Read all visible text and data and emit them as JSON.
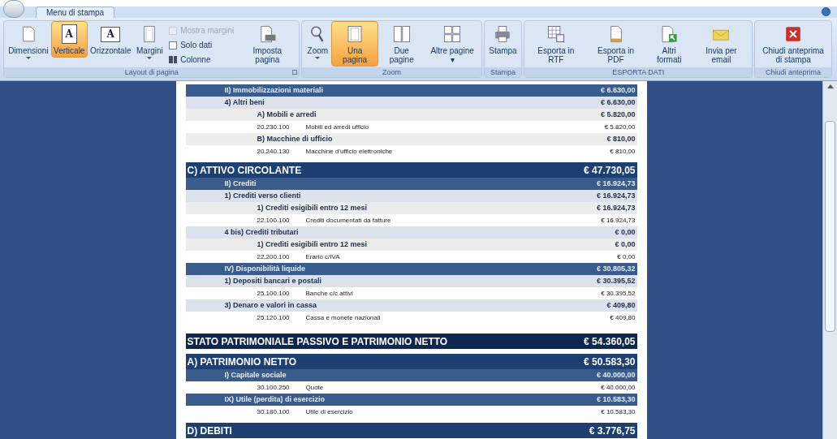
{
  "tabs": [
    {
      "label": "Menu di stampa",
      "selected": true
    }
  ],
  "ribbon": {
    "groups": [
      {
        "label": "Layout di pagina",
        "items": [
          {
            "kind": "button",
            "label": "Dimensioni",
            "dropdown": true,
            "selected": false
          },
          {
            "kind": "button",
            "glyph": "A",
            "label": "Verticale",
            "dropdown": false,
            "selected": true
          },
          {
            "kind": "button",
            "glyph": "A",
            "label": "Orizzontale",
            "dropdown": false,
            "selected": false
          },
          {
            "kind": "button",
            "label": "Margini",
            "dropdown": true,
            "selected": false
          },
          {
            "kind": "options",
            "options": [
              {
                "label": "Mostra margini",
                "kind": "checkbox",
                "checked": false,
                "disabled": true
              },
              {
                "label": "Solo dati",
                "kind": "checkbox",
                "checked": false,
                "disabled": false
              },
              {
                "label": "Colonne",
                "kind": "command"
              }
            ]
          },
          {
            "kind": "button",
            "label": "Imposta pagina",
            "dropdown": false,
            "selected": false
          }
        ]
      },
      {
        "label": "Zoom",
        "items": [
          {
            "kind": "button",
            "label": "Zoom",
            "dropdown": true,
            "selected": false
          },
          {
            "kind": "button",
            "label": "Una pagina",
            "dropdown": false,
            "selected": true
          },
          {
            "kind": "button",
            "label": "Due pagine",
            "dropdown": false,
            "selected": false
          },
          {
            "kind": "button",
            "label": "Altre pagine ▾",
            "dropdown": false,
            "selected": false
          }
        ]
      },
      {
        "label": "Stampa",
        "items": [
          {
            "kind": "button",
            "label": "Stampa",
            "dropdown": false,
            "selected": false
          }
        ]
      },
      {
        "label": "ESPORTA DATI",
        "items": [
          {
            "kind": "button",
            "label": "Esporta in RTF",
            "dropdown": false,
            "selected": false
          },
          {
            "kind": "button",
            "label": "Esporta in PDF",
            "dropdown": false,
            "selected": false
          },
          {
            "kind": "button",
            "label": "Altri formati",
            "dropdown": false,
            "selected": false
          },
          {
            "kind": "button",
            "label": "Invia per email",
            "dropdown": false,
            "selected": false
          }
        ]
      },
      {
        "label": "Chiudi anteprima",
        "items": [
          {
            "kind": "button",
            "label": "Chiudi anteprima di stampa",
            "dropdown": false,
            "selected": false
          }
        ]
      }
    ]
  },
  "report": {
    "rows": [
      {
        "kind": "category",
        "label": "II) Immobilizzazioni materiali",
        "amount": "€ 6.630,00",
        "children": [
          {
            "kind": "item",
            "label": "4) Altri beni",
            "amount": "€ 6.630,00",
            "children": [
              {
                "kind": "subitem",
                "label": "A) Mobili e arredi",
                "amount": "€ 5.820,00",
                "children": [
                  {
                    "kind": "account",
                    "code": "20.230.100",
                    "label": "Mobili ed arredi ufficio",
                    "amount": "€ 5.820,00"
                  }
                ]
              },
              {
                "kind": "subitem",
                "label": "B) Macchine di ufficio",
                "amount": "€ 810,00",
                "children": [
                  {
                    "kind": "account",
                    "code": "20.240.130",
                    "label": "Macchine d'ufficio elettroniche",
                    "amount": "€ 810,00"
                  }
                ]
              }
            ]
          }
        ]
      },
      {
        "kind": "section",
        "label": "C) ATTIVO CIRCOLANTE",
        "amount": "€ 47.730,05",
        "children": [
          {
            "kind": "category",
            "label": "II) Crediti",
            "amount": "€ 16.924,73",
            "children": [
              {
                "kind": "item",
                "label": "1) Crediti verso clienti",
                "amount": "€ 16.924,73",
                "children": [
                  {
                    "kind": "subitem",
                    "label": "1) Crediti esigibili entro 12 mesi",
                    "amount": "€ 16.924,73",
                    "children": [
                      {
                        "kind": "account",
                        "code": "22.100.100",
                        "label": "Crediti documentati da fatture",
                        "amount": "€ 16.924,73"
                      }
                    ]
                  }
                ]
              },
              {
                "kind": "item",
                "label": "4 bis) Crediti tributari",
                "amount": "€ 0,00",
                "children": [
                  {
                    "kind": "subitem",
                    "label": "1) Crediti esigibili entro 12 mesi",
                    "amount": "€ 0,00",
                    "children": [
                      {
                        "kind": "account",
                        "code": "22.200.100",
                        "label": "Erario c/IVA",
                        "amount": "€ 0,00"
                      }
                    ]
                  }
                ]
              }
            ]
          },
          {
            "kind": "category",
            "label": "IV) Disponibilità liquide",
            "amount": "€ 30.805,32",
            "children": [
              {
                "kind": "item",
                "label": "1) Depositi bancari e postali",
                "amount": "€ 30.395,52",
                "children": [
                  {
                    "kind": "account",
                    "code": "25.100.100",
                    "label": "Banche c/c attivi",
                    "amount": "€ 30.395,52"
                  }
                ]
              },
              {
                "kind": "item",
                "label": "3) Denaro e valori in cassa",
                "amount": "€ 409,80",
                "children": [
                  {
                    "kind": "account",
                    "code": "25.120.100",
                    "label": "Cassa e monete nazionali",
                    "amount": "€ 409,80"
                  }
                ]
              }
            ]
          }
        ]
      },
      {
        "kind": "total",
        "label": "STATO PATRIMONIALE PASSIVO E PATRIMONIO NETTO",
        "amount": "€ 54.360,05",
        "children": [
          {
            "kind": "section",
            "label": "A) PATRIMONIO NETTO",
            "amount": "€ 50.583,30",
            "children": [
              {
                "kind": "category",
                "label": "I) Capitale sociale",
                "amount": "€ 40.000,00",
                "children": [
                  {
                    "kind": "account",
                    "code": "30.100.250",
                    "label": "Quote",
                    "amount": "€ 40.000,00"
                  }
                ]
              },
              {
                "kind": "category",
                "label": "IX) Utile (perdita) di esercizio",
                "amount": "€ 10.583,30",
                "children": [
                  {
                    "kind": "account",
                    "code": "30.180.100",
                    "label": "Utile di esercizio",
                    "amount": "€ 10.583,30"
                  }
                ]
              }
            ]
          },
          {
            "kind": "section",
            "label": "D) DEBITI",
            "amount": "€ 3.776,75"
          }
        ]
      }
    ]
  }
}
